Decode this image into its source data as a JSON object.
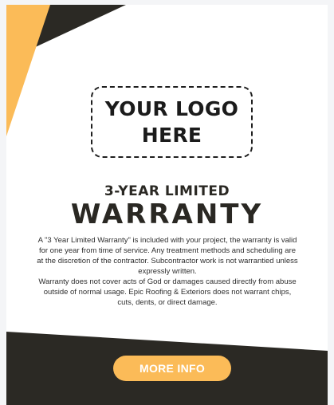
{
  "logo_placeholder": {
    "text": "YOUR LOGO HERE"
  },
  "heading": {
    "subtitle": "3-YEAR LIMITED",
    "title": "WARRANTY"
  },
  "body": {
    "paragraph_1": "A \"3 Year Limited Warranty\" is included with your project, the warranty is valid for one year from time of service. Any treatment methods and scheduling are at the discretion of the contractor. Subcontractor work is not warrantied unless expressly written.",
    "paragraph_2": "Warranty does not cover acts of God or damages caused directly from abuse outside of normal usage. Epic Roofing & Exteriors does not warrant chips, cuts, dents, or direct damage."
  },
  "cta": {
    "label": "MORE INFO"
  },
  "colors": {
    "accent_yellow": "#fbbb58",
    "dark": "#2b2924",
    "background": "#ffffff"
  }
}
